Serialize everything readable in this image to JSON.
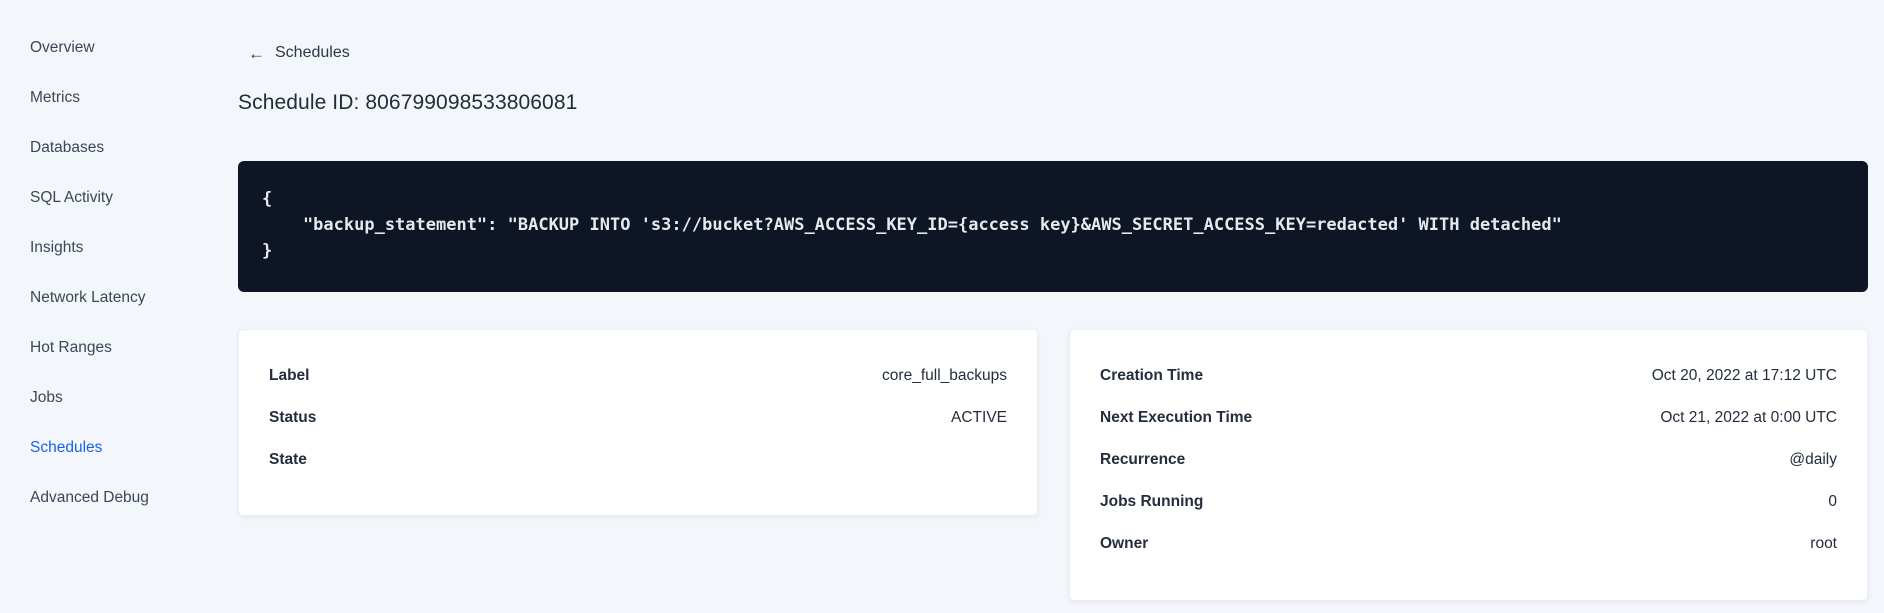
{
  "colors": {
    "accent": "#1a61e8",
    "page_bg": "#f3f6fa",
    "code_bg": "#0e1524",
    "code_text": "#e6e9ee",
    "sidebar_text": "#3c4758",
    "text_primary": "#242d3d"
  },
  "sidebar": {
    "items": [
      {
        "label": "Overview",
        "active": false
      },
      {
        "label": "Metrics",
        "active": false
      },
      {
        "label": "Databases",
        "active": false
      },
      {
        "label": "SQL Activity",
        "active": false
      },
      {
        "label": "Insights",
        "active": false
      },
      {
        "label": "Network Latency",
        "active": false
      },
      {
        "label": "Hot Ranges",
        "active": false
      },
      {
        "label": "Jobs",
        "active": false
      },
      {
        "label": "Schedules",
        "active": true
      },
      {
        "label": "Advanced Debug",
        "active": false
      }
    ]
  },
  "header": {
    "back_arrow": "←",
    "back_label": "Schedules",
    "title": "Schedule ID: 806799098533806081"
  },
  "code": {
    "text": "{\n    \"backup_statement\": \"BACKUP INTO 's3://bucket?AWS_ACCESS_KEY_ID={access key}&AWS_SECRET_ACCESS_KEY=redacted' WITH detached\"\n}"
  },
  "cards": {
    "left": {
      "rows": [
        {
          "label": "Label",
          "value": "core_full_backups"
        },
        {
          "label": "Status",
          "value": "ACTIVE"
        },
        {
          "label": "State",
          "value": ""
        }
      ]
    },
    "right": {
      "rows": [
        {
          "label": "Creation Time",
          "value": "Oct 20, 2022 at 17:12 UTC"
        },
        {
          "label": "Next Execution Time",
          "value": "Oct 21, 2022 at 0:00 UTC"
        },
        {
          "label": "Recurrence",
          "value": "@daily"
        },
        {
          "label": "Jobs Running",
          "value": "0"
        },
        {
          "label": "Owner",
          "value": "root"
        }
      ]
    }
  }
}
